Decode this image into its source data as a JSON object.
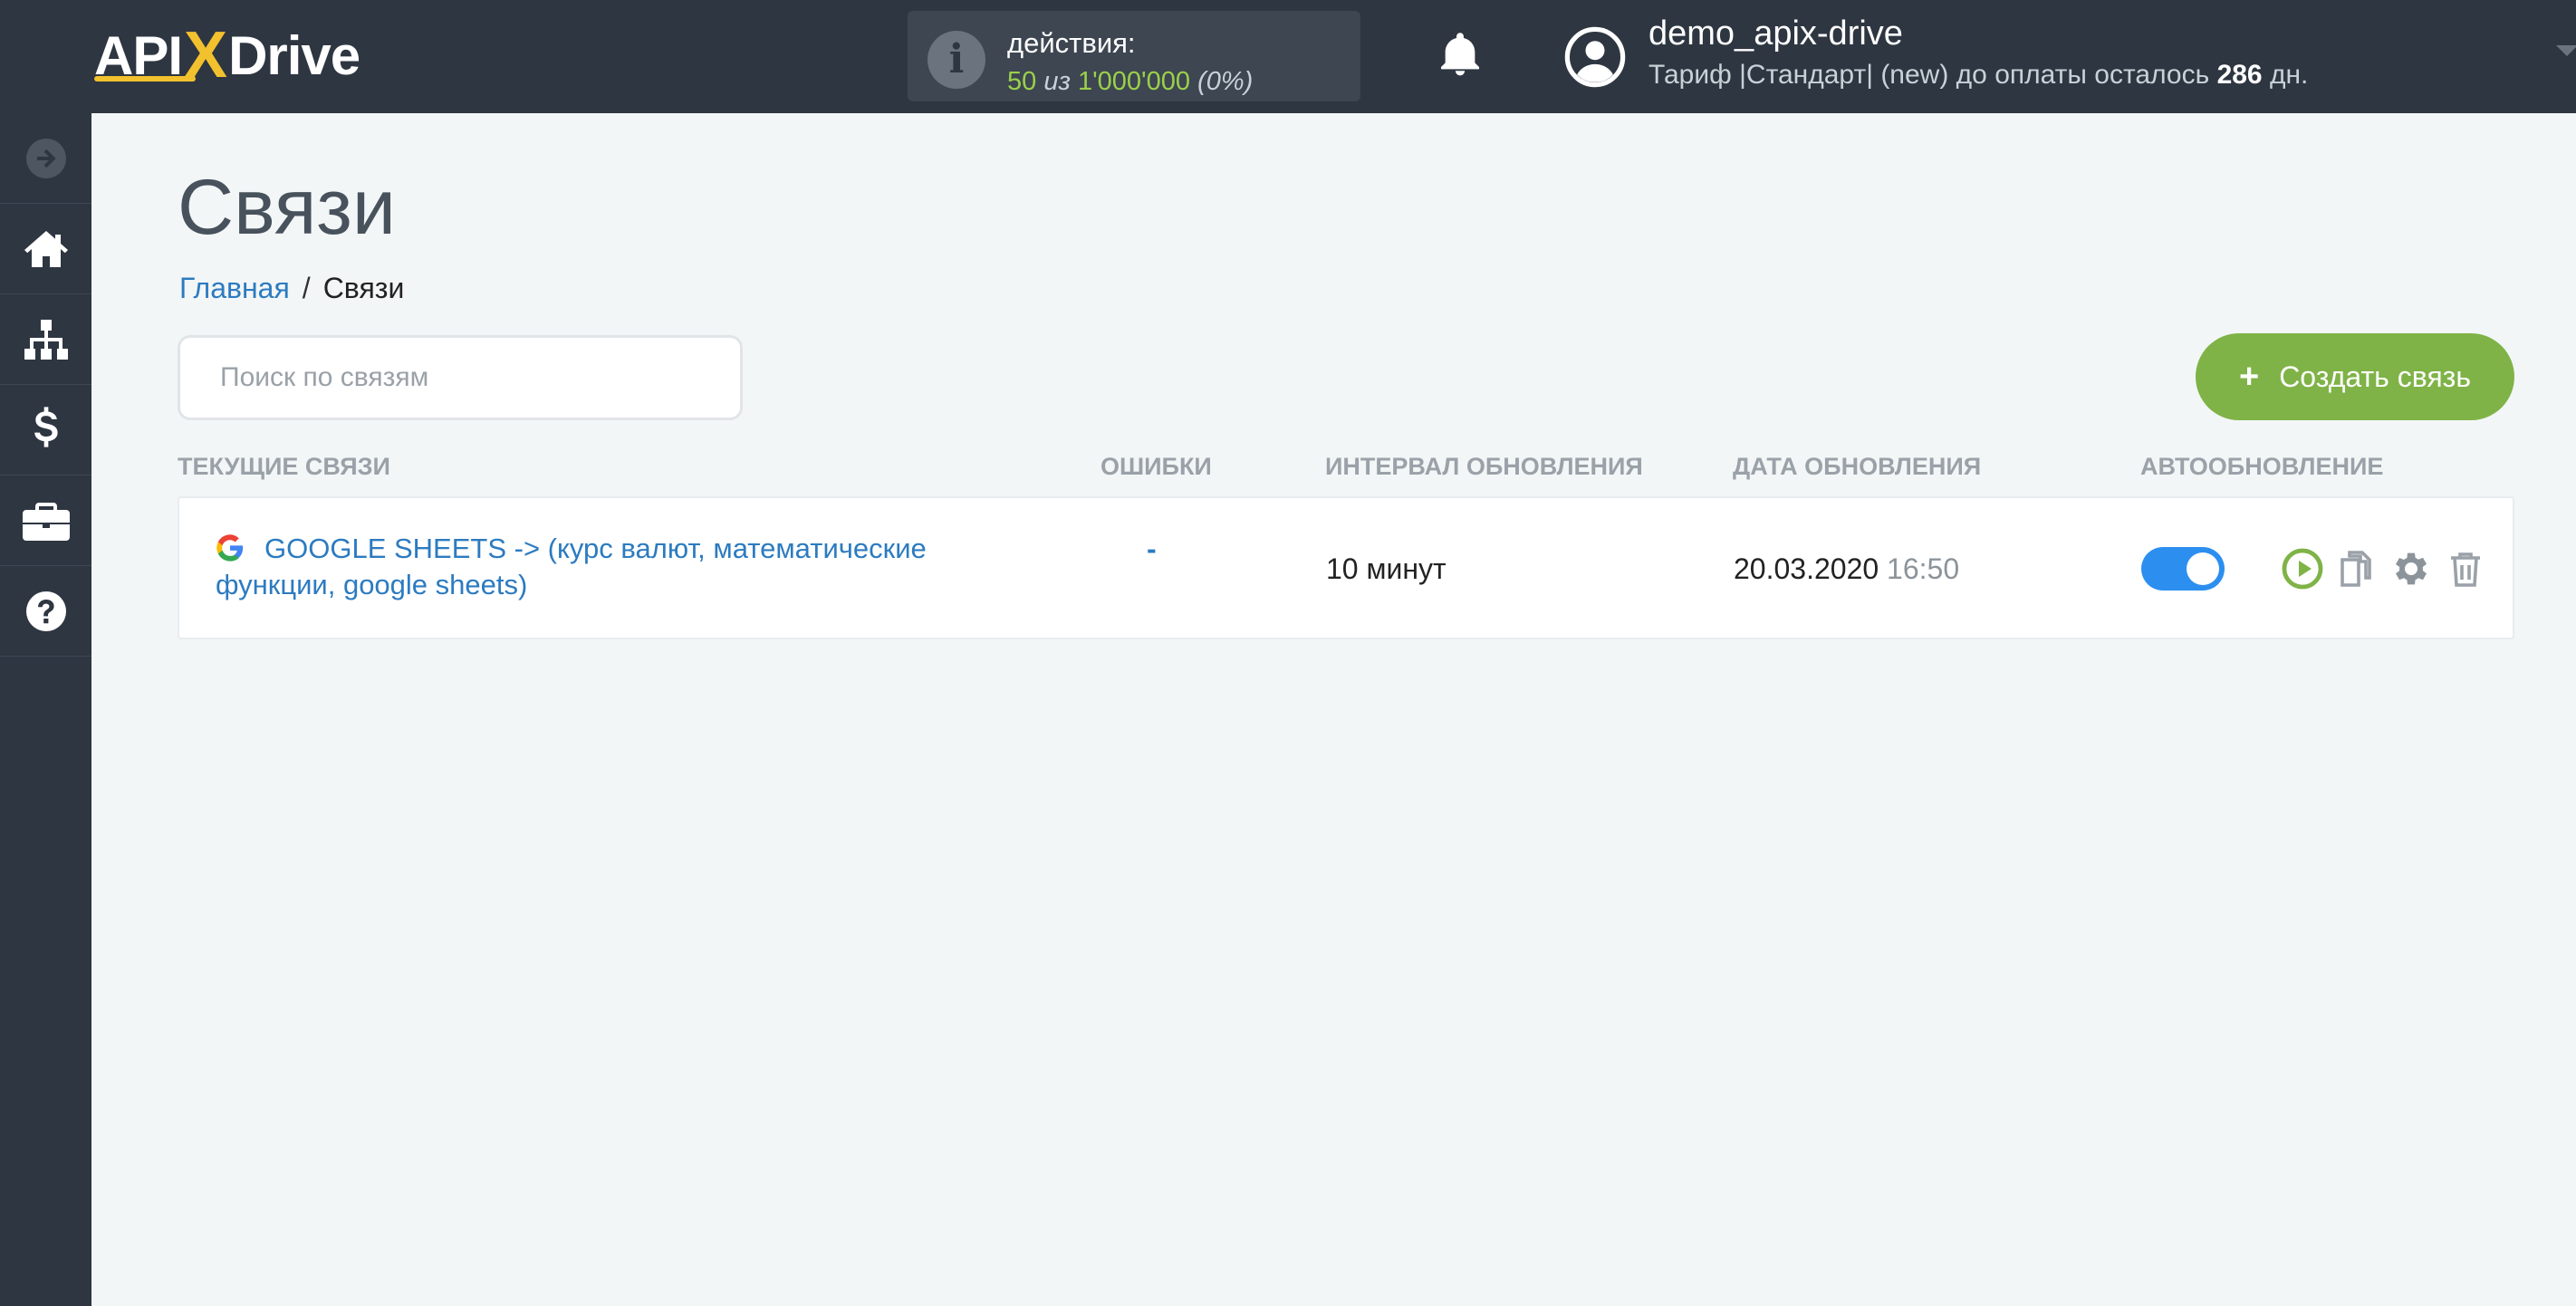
{
  "brand": {
    "logo_left": "API",
    "logo_x": "X",
    "logo_right": "Drive"
  },
  "header": {
    "actions_label": "действия:",
    "actions_used": "50",
    "actions_of": "из",
    "actions_limit": "1'000'000",
    "actions_percent": "(0%)",
    "username": "demo_apix-drive",
    "tariff_text": "Тариф |Стандарт| (new) до оплаты осталось",
    "tariff_days": "286",
    "tariff_days_suffix": "дн."
  },
  "sidebar": {
    "items": [
      {
        "icon": "arrow-right-circle-icon"
      },
      {
        "icon": "home-icon"
      },
      {
        "icon": "sitemap-icon"
      },
      {
        "icon": "dollar-icon"
      },
      {
        "icon": "briefcase-icon"
      },
      {
        "icon": "question-circle-icon"
      }
    ]
  },
  "page": {
    "title": "Связи",
    "breadcrumb_home": "Главная",
    "breadcrumb_sep": "/",
    "breadcrumb_current": "Связи",
    "search_placeholder": "Поиск по связям",
    "create_button": "Создать связь",
    "create_plus": "+"
  },
  "table": {
    "columns": [
      "ТЕКУЩИЕ СВЯЗИ",
      "ОШИБКИ",
      "ИНТЕРВАЛ ОБНОВЛЕНИЯ",
      "ДАТА ОБНОВЛЕНИЯ",
      "АВТООБНОВЛЕНИЕ"
    ],
    "rows": [
      {
        "name": "GOOGLE SHEETS -> (курс валют, математические функции, google sheets)",
        "errors": "-",
        "interval": "10 минут",
        "date": "20.03.2020",
        "time": "16:50",
        "autoupdate": true
      }
    ]
  },
  "colors": {
    "topbar": "#2e3641",
    "accent_green": "#7fb347",
    "link_blue": "#2c7bc0",
    "toggle_blue": "#2c8ff0"
  }
}
